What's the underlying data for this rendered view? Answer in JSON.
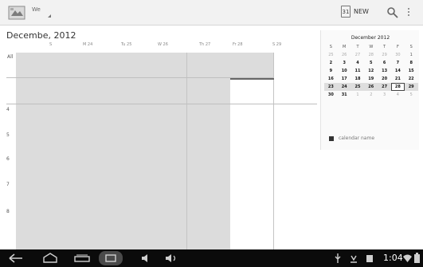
{
  "action_bar": {
    "view_label": "We",
    "today_label": "31",
    "new_label": "NEW",
    "icons": [
      "calendar-app-icon",
      "search-icon",
      "overflow-menu-icon"
    ]
  },
  "week_view": {
    "month_title": "Decembe, 2012",
    "day_headers": [
      "S",
      "M 24",
      "Tu 25",
      "W 26",
      "Th 27",
      "Fr 28",
      "S 29"
    ],
    "allday_label": "All",
    "hour_labels": [
      "4",
      "5",
      "6",
      "7",
      "8"
    ]
  },
  "mini_month": {
    "title": "December 2012",
    "weekdays": [
      "S",
      "M",
      "T",
      "W",
      "T",
      "F",
      "S"
    ],
    "rows": [
      [
        "25",
        "26",
        "27",
        "28",
        "29",
        "30",
        "1"
      ],
      [
        "2",
        "3",
        "4",
        "5",
        "6",
        "7",
        "8"
      ],
      [
        "9",
        "10",
        "11",
        "12",
        "13",
        "14",
        "15"
      ],
      [
        "16",
        "17",
        "18",
        "19",
        "20",
        "21",
        "22"
      ],
      [
        "23",
        "24",
        "25",
        "26",
        "27",
        "28",
        "29"
      ],
      [
        "30",
        "31",
        "1",
        "2",
        "3",
        "4",
        "5"
      ]
    ],
    "calendar_name": "calendar name"
  },
  "system_bar": {
    "time": "1:04",
    "nav_icons": [
      "back-icon",
      "home-icon",
      "recents-icon",
      "screenshot-icon",
      "volume-down-icon",
      "volume-up-icon"
    ],
    "status_icons": [
      "usb-icon",
      "notification-icon",
      "storage-icon",
      "wifi-icon",
      "battery-icon"
    ]
  }
}
